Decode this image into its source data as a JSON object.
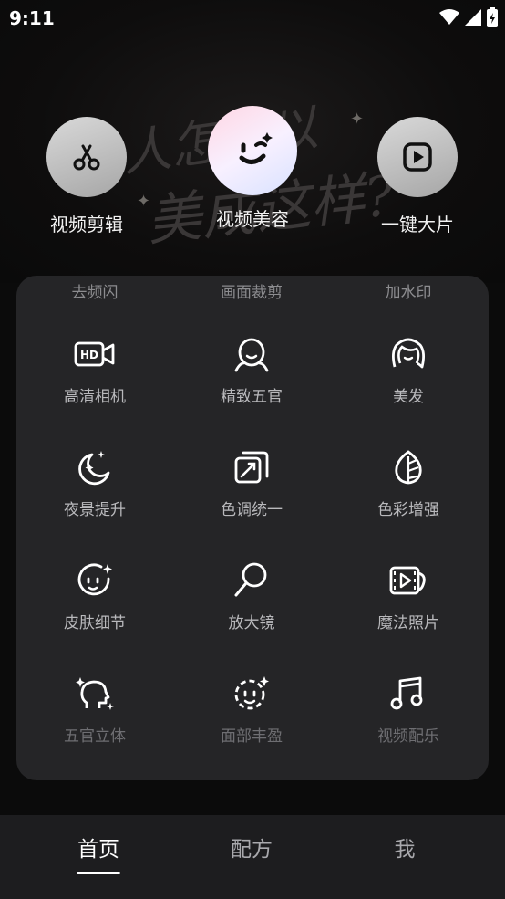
{
  "status_bar": {
    "time": "9:11",
    "icons": [
      "wifi-icon",
      "signal-icon",
      "battery-icon"
    ]
  },
  "background": {
    "line1": "人怎可以",
    "line2": "美成这样?"
  },
  "top_actions": [
    {
      "label": "视频剪辑",
      "icon": "scissors-icon"
    },
    {
      "label": "视频美容",
      "icon": "wink-face-icon"
    },
    {
      "label": "一键大片",
      "icon": "play-icon"
    }
  ],
  "panel": {
    "partial_row": [
      "去频闪",
      "画面裁剪",
      "加水印"
    ],
    "tools": [
      {
        "label": "高清相机",
        "icon": "hd-camera-icon"
      },
      {
        "label": "精致五官",
        "icon": "face-outline-icon"
      },
      {
        "label": "美发",
        "icon": "hair-icon"
      },
      {
        "label": "夜景提升",
        "icon": "moon-sparkle-icon"
      },
      {
        "label": "色调统一",
        "icon": "color-sync-icon"
      },
      {
        "label": "色彩增强",
        "icon": "leaf-color-icon"
      },
      {
        "label": "皮肤细节",
        "icon": "skin-sparkle-icon"
      },
      {
        "label": "放大镜",
        "icon": "magnifier-icon"
      },
      {
        "label": "魔法照片",
        "icon": "magic-photo-icon"
      },
      {
        "label": "五官立体",
        "icon": "head-sparkle-icon"
      },
      {
        "label": "面部丰盈",
        "icon": "dashed-face-icon"
      },
      {
        "label": "视频配乐",
        "icon": "music-note-icon"
      }
    ]
  },
  "bottom_nav": {
    "tabs": [
      {
        "label": "首页"
      },
      {
        "label": "配方"
      },
      {
        "label": "我"
      }
    ],
    "active": "首页"
  },
  "colors": {
    "background": "#0b0b0b",
    "panel": "#252527",
    "nav": "#1d1d1f",
    "text_muted": "#b9b9bc"
  }
}
